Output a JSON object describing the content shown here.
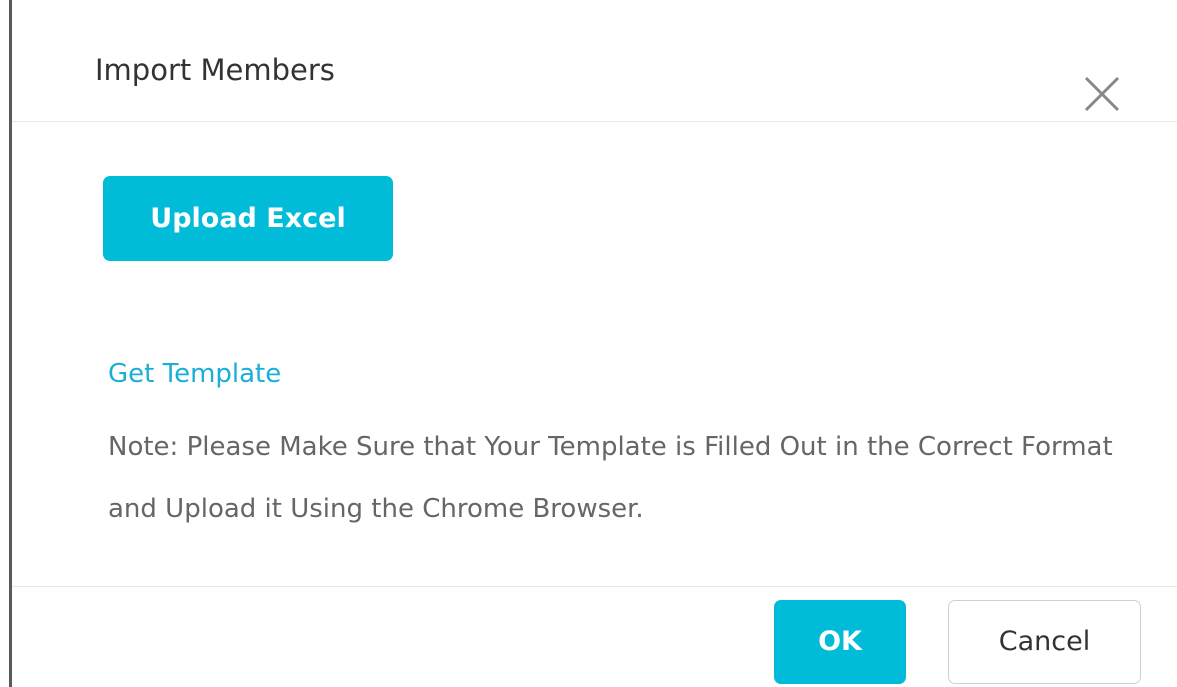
{
  "dialog": {
    "title": "Import Members",
    "close_icon": "close-icon",
    "upload_button_label": "Upload Excel",
    "template_link_label": "Get Template",
    "note_text": "Note: Please Make Sure that Your Template is Filled Out in the Correct Format and Upload it Using the Chrome Browser.",
    "ok_label": "OK",
    "cancel_label": "Cancel"
  },
  "colors": {
    "accent": "#00bcd9",
    "link": "#1aafd6",
    "text_primary": "#333333",
    "text_secondary": "#666666"
  }
}
